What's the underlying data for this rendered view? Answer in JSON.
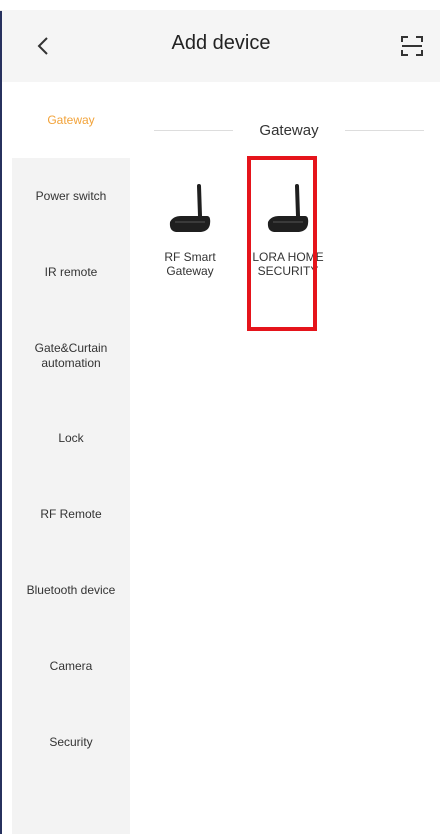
{
  "header": {
    "title": "Add device",
    "back_icon": "chevron-left-icon",
    "scan_icon": "scan-icon"
  },
  "sidebar": {
    "items": [
      {
        "label": "Gateway",
        "active": true
      },
      {
        "label": "Power switch"
      },
      {
        "label": "IR remote"
      },
      {
        "label": "Gate&Curtain automation"
      },
      {
        "label": "Lock"
      },
      {
        "label": "RF Remote"
      },
      {
        "label": "Bluetooth device"
      },
      {
        "label": "Camera"
      },
      {
        "label": "Security"
      }
    ],
    "active_color": "#f2a33a"
  },
  "content": {
    "section_title": "Gateway",
    "devices": [
      {
        "label": "RF Smart Gateway",
        "icon": "router-icon"
      },
      {
        "label": "LORA HOME SECURITY",
        "icon": "router-icon"
      }
    ]
  },
  "colors": {
    "highlight": "#e5141b"
  }
}
